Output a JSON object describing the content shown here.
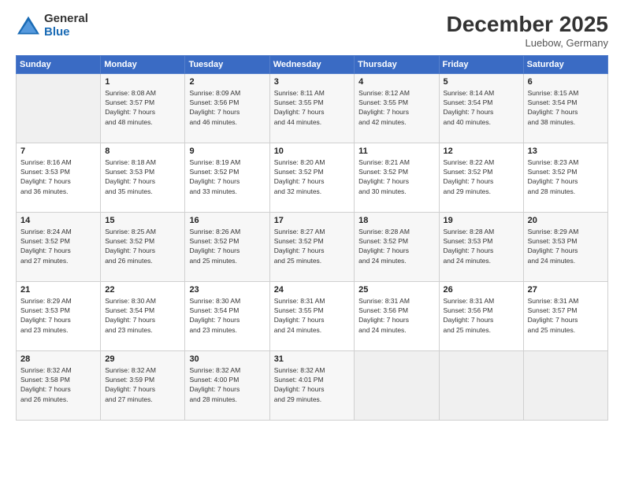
{
  "header": {
    "logo": {
      "general": "General",
      "blue": "Blue"
    },
    "title": "December 2025",
    "location": "Luebow, Germany"
  },
  "calendar": {
    "headers": [
      "Sunday",
      "Monday",
      "Tuesday",
      "Wednesday",
      "Thursday",
      "Friday",
      "Saturday"
    ],
    "rows": [
      [
        {
          "day": "",
          "info": ""
        },
        {
          "day": "1",
          "info": "Sunrise: 8:08 AM\nSunset: 3:57 PM\nDaylight: 7 hours\nand 48 minutes."
        },
        {
          "day": "2",
          "info": "Sunrise: 8:09 AM\nSunset: 3:56 PM\nDaylight: 7 hours\nand 46 minutes."
        },
        {
          "day": "3",
          "info": "Sunrise: 8:11 AM\nSunset: 3:55 PM\nDaylight: 7 hours\nand 44 minutes."
        },
        {
          "day": "4",
          "info": "Sunrise: 8:12 AM\nSunset: 3:55 PM\nDaylight: 7 hours\nand 42 minutes."
        },
        {
          "day": "5",
          "info": "Sunrise: 8:14 AM\nSunset: 3:54 PM\nDaylight: 7 hours\nand 40 minutes."
        },
        {
          "day": "6",
          "info": "Sunrise: 8:15 AM\nSunset: 3:54 PM\nDaylight: 7 hours\nand 38 minutes."
        }
      ],
      [
        {
          "day": "7",
          "info": "Sunrise: 8:16 AM\nSunset: 3:53 PM\nDaylight: 7 hours\nand 36 minutes."
        },
        {
          "day": "8",
          "info": "Sunrise: 8:18 AM\nSunset: 3:53 PM\nDaylight: 7 hours\nand 35 minutes."
        },
        {
          "day": "9",
          "info": "Sunrise: 8:19 AM\nSunset: 3:52 PM\nDaylight: 7 hours\nand 33 minutes."
        },
        {
          "day": "10",
          "info": "Sunrise: 8:20 AM\nSunset: 3:52 PM\nDaylight: 7 hours\nand 32 minutes."
        },
        {
          "day": "11",
          "info": "Sunrise: 8:21 AM\nSunset: 3:52 PM\nDaylight: 7 hours\nand 30 minutes."
        },
        {
          "day": "12",
          "info": "Sunrise: 8:22 AM\nSunset: 3:52 PM\nDaylight: 7 hours\nand 29 minutes."
        },
        {
          "day": "13",
          "info": "Sunrise: 8:23 AM\nSunset: 3:52 PM\nDaylight: 7 hours\nand 28 minutes."
        }
      ],
      [
        {
          "day": "14",
          "info": "Sunrise: 8:24 AM\nSunset: 3:52 PM\nDaylight: 7 hours\nand 27 minutes."
        },
        {
          "day": "15",
          "info": "Sunrise: 8:25 AM\nSunset: 3:52 PM\nDaylight: 7 hours\nand 26 minutes."
        },
        {
          "day": "16",
          "info": "Sunrise: 8:26 AM\nSunset: 3:52 PM\nDaylight: 7 hours\nand 25 minutes."
        },
        {
          "day": "17",
          "info": "Sunrise: 8:27 AM\nSunset: 3:52 PM\nDaylight: 7 hours\nand 25 minutes."
        },
        {
          "day": "18",
          "info": "Sunrise: 8:28 AM\nSunset: 3:52 PM\nDaylight: 7 hours\nand 24 minutes."
        },
        {
          "day": "19",
          "info": "Sunrise: 8:28 AM\nSunset: 3:53 PM\nDaylight: 7 hours\nand 24 minutes."
        },
        {
          "day": "20",
          "info": "Sunrise: 8:29 AM\nSunset: 3:53 PM\nDaylight: 7 hours\nand 24 minutes."
        }
      ],
      [
        {
          "day": "21",
          "info": "Sunrise: 8:29 AM\nSunset: 3:53 PM\nDaylight: 7 hours\nand 23 minutes."
        },
        {
          "day": "22",
          "info": "Sunrise: 8:30 AM\nSunset: 3:54 PM\nDaylight: 7 hours\nand 23 minutes."
        },
        {
          "day": "23",
          "info": "Sunrise: 8:30 AM\nSunset: 3:54 PM\nDaylight: 7 hours\nand 23 minutes."
        },
        {
          "day": "24",
          "info": "Sunrise: 8:31 AM\nSunset: 3:55 PM\nDaylight: 7 hours\nand 24 minutes."
        },
        {
          "day": "25",
          "info": "Sunrise: 8:31 AM\nSunset: 3:56 PM\nDaylight: 7 hours\nand 24 minutes."
        },
        {
          "day": "26",
          "info": "Sunrise: 8:31 AM\nSunset: 3:56 PM\nDaylight: 7 hours\nand 25 minutes."
        },
        {
          "day": "27",
          "info": "Sunrise: 8:31 AM\nSunset: 3:57 PM\nDaylight: 7 hours\nand 25 minutes."
        }
      ],
      [
        {
          "day": "28",
          "info": "Sunrise: 8:32 AM\nSunset: 3:58 PM\nDaylight: 7 hours\nand 26 minutes."
        },
        {
          "day": "29",
          "info": "Sunrise: 8:32 AM\nSunset: 3:59 PM\nDaylight: 7 hours\nand 27 minutes."
        },
        {
          "day": "30",
          "info": "Sunrise: 8:32 AM\nSunset: 4:00 PM\nDaylight: 7 hours\nand 28 minutes."
        },
        {
          "day": "31",
          "info": "Sunrise: 8:32 AM\nSunset: 4:01 PM\nDaylight: 7 hours\nand 29 minutes."
        },
        {
          "day": "",
          "info": ""
        },
        {
          "day": "",
          "info": ""
        },
        {
          "day": "",
          "info": ""
        }
      ]
    ]
  }
}
